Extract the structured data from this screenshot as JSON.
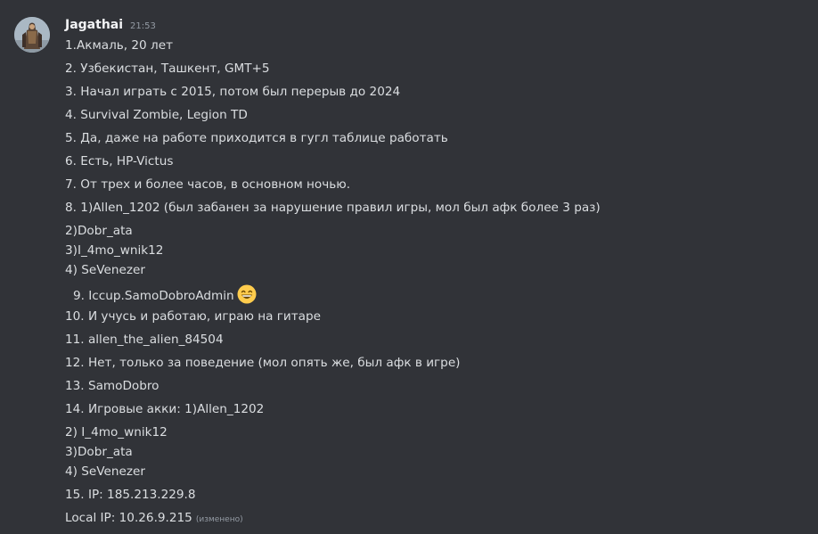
{
  "message": {
    "author": "Jagathai",
    "time": "21:53",
    "lines": [
      "1.Акмаль, 20 лет",
      "2. Узбекистан, Ташкент, GMT+5",
      "3. Начал играть с 2015, потом был перерыв до 2024",
      "4. Survival Zombie, Legion TD",
      "5. Да, даже на работе приходится в гугл таблице работать",
      "6. Есть, HP-Victus",
      "7. От трех и более часов, в основном ночью.",
      "8. 1)Allen_1202 (был забанен за нарушение правил игры, мол был афк более 3 раз)",
      "2)Dobr_ata",
      "3)I_4mo_wnik12",
      "4) SeVenezer",
      "9. Iccup.SamoDobroAdmin",
      "10. И учусь и работаю, играю на гитаре",
      "11. allen_the_alien_84504",
      "12. Нет, только за поведение (мол опять же, был афк в игре)",
      "13. SamoDobro",
      "14. Игровые акки: 1)Allen_1202",
      "2) I_4mo_wnik12",
      "3)Dobr_ata",
      "4) SeVenezer",
      "15. IP: 185.213.229.8",
      "Local IP: 10.26.9.215"
    ],
    "emoji": "grinning-face-with-smiling-eyes",
    "edited_label": "(изменено)"
  },
  "colors": {
    "background": "#313338",
    "text": "#dbdee1",
    "username": "#f2f3f5",
    "muted": "#949ba4"
  }
}
